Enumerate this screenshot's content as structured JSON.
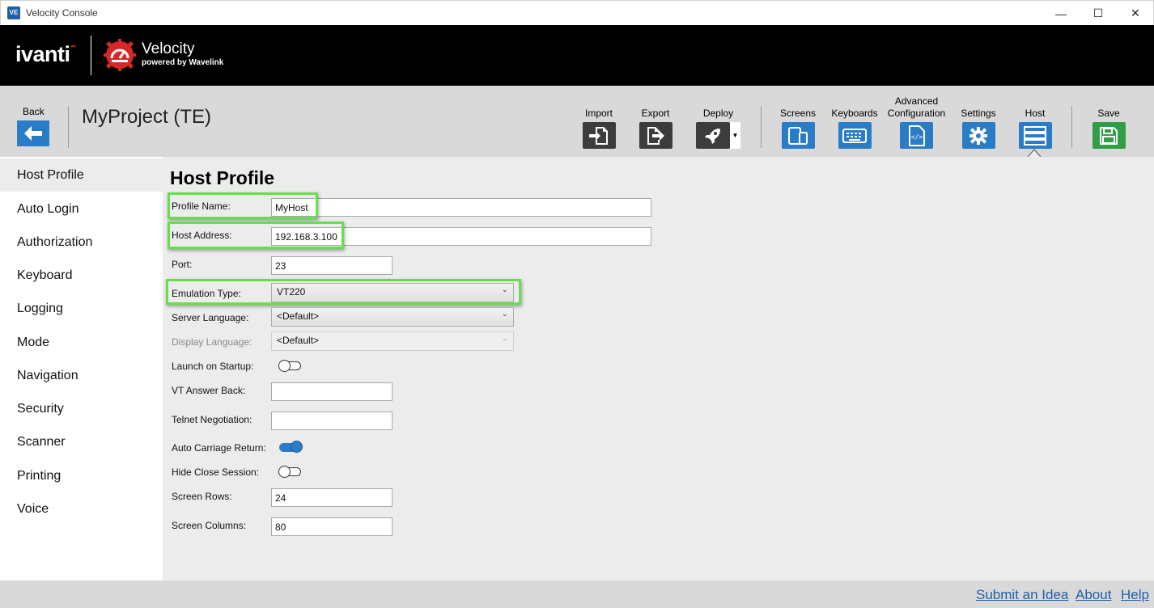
{
  "window": {
    "app_icon": "VE",
    "title": "Velocity Console",
    "minimize": "—",
    "maximize": "☐",
    "close": "✕"
  },
  "brand": {
    "ivanti": "ivanti",
    "ivanti_mark": "▪▪",
    "product": "Velocity",
    "tagline": "powered by Wavelink"
  },
  "toolbar": {
    "back_label": "Back",
    "project_title": "MyProject (TE)",
    "tools": {
      "import": "Import",
      "export": "Export",
      "deploy": "Deploy",
      "screens": "Screens",
      "keyboards": "Keyboards",
      "advanced_line1": "Advanced",
      "advanced_line2": "Configuration",
      "settings": "Settings",
      "host": "Host",
      "save": "Save"
    }
  },
  "sidebar": {
    "items": [
      {
        "label": "Host Profile",
        "active": true
      },
      {
        "label": "Auto Login"
      },
      {
        "label": "Authorization"
      },
      {
        "label": "Keyboard"
      },
      {
        "label": "Logging"
      },
      {
        "label": "Mode"
      },
      {
        "label": "Navigation"
      },
      {
        "label": "Security"
      },
      {
        "label": "Scanner"
      },
      {
        "label": "Printing"
      },
      {
        "label": "Voice"
      }
    ]
  },
  "form": {
    "title": "Host Profile",
    "profile_name": {
      "label": "Profile Name:",
      "value": "MyHost"
    },
    "host_address": {
      "label": "Host Address:",
      "value": "192.168.3.100"
    },
    "port": {
      "label": "Port:",
      "value": "23"
    },
    "emulation_type": {
      "label": "Emulation Type:",
      "value": "VT220"
    },
    "server_language": {
      "label": "Server Language:",
      "value": "<Default>"
    },
    "display_language": {
      "label": "Display Language:",
      "value": "<Default>",
      "disabled": true
    },
    "launch_on_startup": {
      "label": "Launch on Startup:",
      "on": false
    },
    "vt_answer_back": {
      "label": "VT Answer Back:",
      "value": ""
    },
    "telnet_negotiation": {
      "label": "Telnet Negotiation:",
      "value": ""
    },
    "auto_carriage_return": {
      "label": "Auto Carriage Return:",
      "on": true
    },
    "hide_close_session": {
      "label": "Hide Close Session:",
      "on": false
    },
    "screen_rows": {
      "label": "Screen Rows:",
      "value": "24"
    },
    "screen_columns": {
      "label": "Screen Columns:",
      "value": "80"
    }
  },
  "footer": {
    "submit_idea": "Submit an Idea",
    "about": "About",
    "help": "Help"
  },
  "colors": {
    "accent_blue": "#2a7cc7",
    "save_green": "#2f9e46",
    "highlight_green": "#66e04a",
    "brand_red": "#d62828"
  }
}
